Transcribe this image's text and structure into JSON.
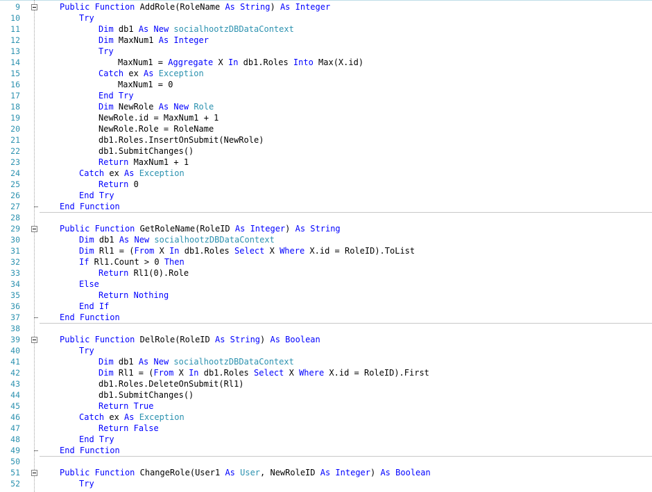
{
  "window": {
    "kind": "code-editor",
    "language": "VB.NET"
  },
  "colors": {
    "keyword": "#0000ff",
    "type": "#2b91af",
    "line_number": "#2b91af",
    "text": "#000000"
  },
  "lines": [
    {
      "n": "9",
      "indent": 0,
      "tokens": [
        [
          "k",
          "Public"
        ],
        [
          "t",
          " "
        ],
        [
          "k",
          "Function"
        ],
        [
          "t",
          " AddRole(RoleName "
        ],
        [
          "k",
          "As"
        ],
        [
          "t",
          " "
        ],
        [
          "k",
          "String"
        ],
        [
          "t",
          ") "
        ],
        [
          "k",
          "As"
        ],
        [
          "t",
          " "
        ],
        [
          "k",
          "Integer"
        ]
      ]
    },
    {
      "n": "10",
      "indent": 1,
      "tokens": [
        [
          "k",
          "Try"
        ]
      ]
    },
    {
      "n": "11",
      "indent": 2,
      "tokens": [
        [
          "k",
          "Dim"
        ],
        [
          "t",
          " db1 "
        ],
        [
          "k",
          "As"
        ],
        [
          "t",
          " "
        ],
        [
          "k",
          "New"
        ],
        [
          "t",
          " "
        ],
        [
          "y",
          "socialhootzDBDataContext"
        ]
      ]
    },
    {
      "n": "12",
      "indent": 2,
      "tokens": [
        [
          "k",
          "Dim"
        ],
        [
          "t",
          " MaxNum1 "
        ],
        [
          "k",
          "As"
        ],
        [
          "t",
          " "
        ],
        [
          "k",
          "Integer"
        ]
      ]
    },
    {
      "n": "13",
      "indent": 2,
      "tokens": [
        [
          "k",
          "Try"
        ]
      ]
    },
    {
      "n": "14",
      "indent": 3,
      "tokens": [
        [
          "t",
          "MaxNum1 = "
        ],
        [
          "k",
          "Aggregate"
        ],
        [
          "t",
          " X "
        ],
        [
          "k",
          "In"
        ],
        [
          "t",
          " db1.Roles "
        ],
        [
          "k",
          "Into"
        ],
        [
          "t",
          " Max(X.id)"
        ]
      ]
    },
    {
      "n": "15",
      "indent": 2,
      "tokens": [
        [
          "k",
          "Catch"
        ],
        [
          "t",
          " ex "
        ],
        [
          "k",
          "As"
        ],
        [
          "t",
          " "
        ],
        [
          "y",
          "Exception"
        ]
      ]
    },
    {
      "n": "16",
      "indent": 3,
      "tokens": [
        [
          "t",
          "MaxNum1 = 0"
        ]
      ]
    },
    {
      "n": "17",
      "indent": 2,
      "tokens": [
        [
          "k",
          "End Try"
        ]
      ]
    },
    {
      "n": "18",
      "indent": 2,
      "tokens": [
        [
          "k",
          "Dim"
        ],
        [
          "t",
          " NewRole "
        ],
        [
          "k",
          "As"
        ],
        [
          "t",
          " "
        ],
        [
          "k",
          "New"
        ],
        [
          "t",
          " "
        ],
        [
          "y",
          "Role"
        ]
      ]
    },
    {
      "n": "19",
      "indent": 2,
      "tokens": [
        [
          "t",
          "NewRole.id = MaxNum1 + 1"
        ]
      ]
    },
    {
      "n": "20",
      "indent": 2,
      "tokens": [
        [
          "t",
          "NewRole.Role = RoleName"
        ]
      ]
    },
    {
      "n": "21",
      "indent": 2,
      "tokens": [
        [
          "t",
          "db1.Roles.InsertOnSubmit(NewRole)"
        ]
      ]
    },
    {
      "n": "22",
      "indent": 2,
      "tokens": [
        [
          "t",
          "db1.SubmitChanges()"
        ]
      ]
    },
    {
      "n": "23",
      "indent": 2,
      "tokens": [
        [
          "k",
          "Return"
        ],
        [
          "t",
          " MaxNum1 + 1"
        ]
      ]
    },
    {
      "n": "24",
      "indent": 1,
      "tokens": [
        [
          "k",
          "Catch"
        ],
        [
          "t",
          " ex "
        ],
        [
          "k",
          "As"
        ],
        [
          "t",
          " "
        ],
        [
          "y",
          "Exception"
        ]
      ]
    },
    {
      "n": "25",
      "indent": 2,
      "tokens": [
        [
          "k",
          "Return"
        ],
        [
          "t",
          " 0"
        ]
      ]
    },
    {
      "n": "26",
      "indent": 1,
      "tokens": [
        [
          "k",
          "End Try"
        ]
      ]
    },
    {
      "n": "27",
      "indent": 0,
      "tokens": [
        [
          "k",
          "End Function"
        ]
      ]
    },
    {
      "n": "28",
      "indent": 0,
      "tokens": []
    },
    {
      "n": "29",
      "indent": 0,
      "tokens": [
        [
          "k",
          "Public"
        ],
        [
          "t",
          " "
        ],
        [
          "k",
          "Function"
        ],
        [
          "t",
          " GetRoleName(RoleID "
        ],
        [
          "k",
          "As"
        ],
        [
          "t",
          " "
        ],
        [
          "k",
          "Integer"
        ],
        [
          "t",
          ") "
        ],
        [
          "k",
          "As"
        ],
        [
          "t",
          " "
        ],
        [
          "k",
          "String"
        ]
      ]
    },
    {
      "n": "30",
      "indent": 1,
      "tokens": [
        [
          "k",
          "Dim"
        ],
        [
          "t",
          " db1 "
        ],
        [
          "k",
          "As"
        ],
        [
          "t",
          " "
        ],
        [
          "k",
          "New"
        ],
        [
          "t",
          " "
        ],
        [
          "y",
          "socialhootzDBDataContext"
        ]
      ]
    },
    {
      "n": "31",
      "indent": 1,
      "tokens": [
        [
          "k",
          "Dim"
        ],
        [
          "t",
          " Rl1 = ("
        ],
        [
          "k",
          "From"
        ],
        [
          "t",
          " X "
        ],
        [
          "k",
          "In"
        ],
        [
          "t",
          " db1.Roles "
        ],
        [
          "k",
          "Select"
        ],
        [
          "t",
          " X "
        ],
        [
          "k",
          "Where"
        ],
        [
          "t",
          " X.id = RoleID).ToList"
        ]
      ]
    },
    {
      "n": "32",
      "indent": 1,
      "tokens": [
        [
          "k",
          "If"
        ],
        [
          "t",
          " Rl1.Count > 0 "
        ],
        [
          "k",
          "Then"
        ]
      ]
    },
    {
      "n": "33",
      "indent": 2,
      "tokens": [
        [
          "k",
          "Return"
        ],
        [
          "t",
          " Rl1(0).Role"
        ]
      ]
    },
    {
      "n": "34",
      "indent": 1,
      "tokens": [
        [
          "k",
          "Else"
        ]
      ]
    },
    {
      "n": "35",
      "indent": 2,
      "tokens": [
        [
          "k",
          "Return"
        ],
        [
          "t",
          " "
        ],
        [
          "k",
          "Nothing"
        ]
      ]
    },
    {
      "n": "36",
      "indent": 1,
      "tokens": [
        [
          "k",
          "End If"
        ]
      ]
    },
    {
      "n": "37",
      "indent": 0,
      "tokens": [
        [
          "k",
          "End Function"
        ]
      ]
    },
    {
      "n": "38",
      "indent": 0,
      "tokens": []
    },
    {
      "n": "39",
      "indent": 0,
      "tokens": [
        [
          "k",
          "Public"
        ],
        [
          "t",
          " "
        ],
        [
          "k",
          "Function"
        ],
        [
          "t",
          " DelRole(RoleID "
        ],
        [
          "k",
          "As"
        ],
        [
          "t",
          " "
        ],
        [
          "k",
          "String"
        ],
        [
          "t",
          ") "
        ],
        [
          "k",
          "As"
        ],
        [
          "t",
          " "
        ],
        [
          "k",
          "Boolean"
        ]
      ]
    },
    {
      "n": "40",
      "indent": 1,
      "tokens": [
        [
          "k",
          "Try"
        ]
      ]
    },
    {
      "n": "41",
      "indent": 2,
      "tokens": [
        [
          "k",
          "Dim"
        ],
        [
          "t",
          " db1 "
        ],
        [
          "k",
          "As"
        ],
        [
          "t",
          " "
        ],
        [
          "k",
          "New"
        ],
        [
          "t",
          " "
        ],
        [
          "y",
          "socialhootzDBDataContext"
        ]
      ]
    },
    {
      "n": "42",
      "indent": 2,
      "tokens": [
        [
          "k",
          "Dim"
        ],
        [
          "t",
          " Rl1 = ("
        ],
        [
          "k",
          "From"
        ],
        [
          "t",
          " X "
        ],
        [
          "k",
          "In"
        ],
        [
          "t",
          " db1.Roles "
        ],
        [
          "k",
          "Select"
        ],
        [
          "t",
          " X "
        ],
        [
          "k",
          "Where"
        ],
        [
          "t",
          " X.id = RoleID).First"
        ]
      ]
    },
    {
      "n": "43",
      "indent": 2,
      "tokens": [
        [
          "t",
          "db1.Roles.DeleteOnSubmit(Rl1)"
        ]
      ]
    },
    {
      "n": "44",
      "indent": 2,
      "tokens": [
        [
          "t",
          "db1.SubmitChanges()"
        ]
      ]
    },
    {
      "n": "45",
      "indent": 2,
      "tokens": [
        [
          "k",
          "Return"
        ],
        [
          "t",
          " "
        ],
        [
          "k",
          "True"
        ]
      ]
    },
    {
      "n": "46",
      "indent": 1,
      "tokens": [
        [
          "k",
          "Catch"
        ],
        [
          "t",
          " ex "
        ],
        [
          "k",
          "As"
        ],
        [
          "t",
          " "
        ],
        [
          "y",
          "Exception"
        ]
      ]
    },
    {
      "n": "47",
      "indent": 2,
      "tokens": [
        [
          "k",
          "Return"
        ],
        [
          "t",
          " "
        ],
        [
          "k",
          "False"
        ]
      ]
    },
    {
      "n": "48",
      "indent": 1,
      "tokens": [
        [
          "k",
          "End Try"
        ]
      ]
    },
    {
      "n": "49",
      "indent": 0,
      "tokens": [
        [
          "k",
          "End Function"
        ]
      ]
    },
    {
      "n": "50",
      "indent": 0,
      "tokens": []
    },
    {
      "n": "51",
      "indent": 0,
      "tokens": [
        [
          "k",
          "Public"
        ],
        [
          "t",
          " "
        ],
        [
          "k",
          "Function"
        ],
        [
          "t",
          " ChangeRole(User1 "
        ],
        [
          "k",
          "As"
        ],
        [
          "t",
          " "
        ],
        [
          "y",
          "User"
        ],
        [
          "t",
          ", NewRoleID "
        ],
        [
          "k",
          "As"
        ],
        [
          "t",
          " "
        ],
        [
          "k",
          "Integer"
        ],
        [
          "t",
          ") "
        ],
        [
          "k",
          "As"
        ],
        [
          "t",
          " "
        ],
        [
          "k",
          "Boolean"
        ]
      ]
    },
    {
      "n": "52",
      "indent": 1,
      "tokens": [
        [
          "k",
          "Try"
        ]
      ]
    }
  ]
}
